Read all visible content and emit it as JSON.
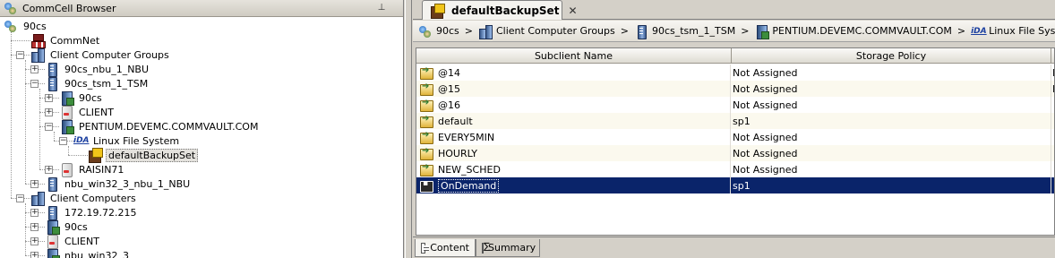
{
  "left_panel": {
    "title": "CommCell Browser",
    "pin_icon": "pin-icon",
    "tree": [
      {
        "label": "90cs",
        "icon": "commcell-icon",
        "depth": 0,
        "expander": "",
        "selected": false
      },
      {
        "label": "CommNet",
        "icon": "commnet-icon",
        "depth": 1,
        "expander": "",
        "selected": false
      },
      {
        "label": "Client Computer Groups",
        "icon": "client-group-icon",
        "depth": 1,
        "expander": "−",
        "selected": false
      },
      {
        "label": "90cs_nbu_1_NBU",
        "icon": "media-agent-icon",
        "depth": 2,
        "expander": "+",
        "selected": false
      },
      {
        "label": "90cs_tsm_1_TSM",
        "icon": "media-agent-icon",
        "depth": 2,
        "expander": "−",
        "selected": false
      },
      {
        "label": "90cs",
        "icon": "media-server-icon",
        "depth": 3,
        "expander": "+",
        "selected": false
      },
      {
        "label": "CLIENT",
        "icon": "client-icon",
        "depth": 3,
        "expander": "+",
        "selected": false
      },
      {
        "label": "PENTIUM.DEVEMC.COMMVAULT.COM",
        "icon": "media-server-icon",
        "depth": 3,
        "expander": "−",
        "selected": false
      },
      {
        "label": "Linux File System",
        "icon": "ida-icon",
        "depth": 4,
        "expander": "−",
        "selected": false
      },
      {
        "label": "defaultBackupSet",
        "icon": "backupset-icon",
        "depth": 5,
        "expander": "",
        "selected": true
      },
      {
        "label": "RAISIN71",
        "icon": "client-icon",
        "depth": 3,
        "expander": "+",
        "selected": false
      },
      {
        "label": "nbu_win32_3_nbu_1_NBU",
        "icon": "media-agent-icon",
        "depth": 2,
        "expander": "+",
        "selected": false
      },
      {
        "label": "Client Computers",
        "icon": "client-group-icon",
        "depth": 1,
        "expander": "−",
        "selected": false
      },
      {
        "label": "172.19.72.215",
        "icon": "media-agent-icon",
        "depth": 2,
        "expander": "+",
        "selected": false
      },
      {
        "label": "90cs",
        "icon": "media-server-icon",
        "depth": 2,
        "expander": "+",
        "selected": false
      },
      {
        "label": "CLIENT",
        "icon": "client-icon",
        "depth": 2,
        "expander": "+",
        "selected": false
      },
      {
        "label": "nbu_win32_3",
        "icon": "media-server-icon",
        "depth": 2,
        "expander": "+",
        "selected": false
      }
    ]
  },
  "document_tab": {
    "label": "defaultBackupSet",
    "icon": "backupset-icon",
    "close_icon": "close-icon",
    "close_glyph": "✕"
  },
  "breadcrumb": [
    {
      "label": "90cs",
      "icon": "commcell-icon"
    },
    {
      "label": "Client Computer Groups",
      "icon": "client-group-icon"
    },
    {
      "label": "90cs_tsm_1_TSM",
      "icon": "media-agent-icon"
    },
    {
      "label": "PENTIUM.DEVEMC.COMMVAULT.COM",
      "icon": "media-server-icon"
    },
    {
      "label": "Linux File System",
      "icon": "ida-icon"
    },
    {
      "label": "",
      "icon": "backupset-icon"
    }
  ],
  "breadcrumb_separator": ">",
  "grid": {
    "columns": [
      "Subclient Name",
      "Storage Policy",
      ""
    ],
    "rows": [
      {
        "name": "@14",
        "policy": "Not Assigned",
        "extra": "D",
        "icon": "subclient-icon",
        "selected": false
      },
      {
        "name": "@15",
        "policy": "Not Assigned",
        "extra": "D",
        "icon": "subclient-icon",
        "selected": false
      },
      {
        "name": "@16",
        "policy": "Not Assigned",
        "extra": "",
        "icon": "subclient-icon",
        "selected": false
      },
      {
        "name": "default",
        "policy": "sp1",
        "extra": "",
        "icon": "subclient-icon",
        "selected": false
      },
      {
        "name": "EVERY5MIN",
        "policy": "Not Assigned",
        "extra": "",
        "icon": "subclient-icon",
        "selected": false
      },
      {
        "name": "HOURLY",
        "policy": "Not Assigned",
        "extra": "",
        "icon": "subclient-icon",
        "selected": false
      },
      {
        "name": "NEW_SCHED",
        "policy": "Not Assigned",
        "extra": "",
        "icon": "subclient-icon",
        "selected": false
      },
      {
        "name": "OnDemand",
        "policy": "sp1",
        "extra": "",
        "icon": "ondemand-subclient-icon",
        "selected": true
      }
    ]
  },
  "bottom_tabs": [
    {
      "label": "Content",
      "icon": "content-grid-icon",
      "active": true
    },
    {
      "label": "Summary",
      "icon": "summary-icon",
      "active": false
    }
  ],
  "colors": {
    "selection": "#0a246a",
    "alt_row": "#fbf9ee",
    "chrome": "#d4d0c8"
  }
}
